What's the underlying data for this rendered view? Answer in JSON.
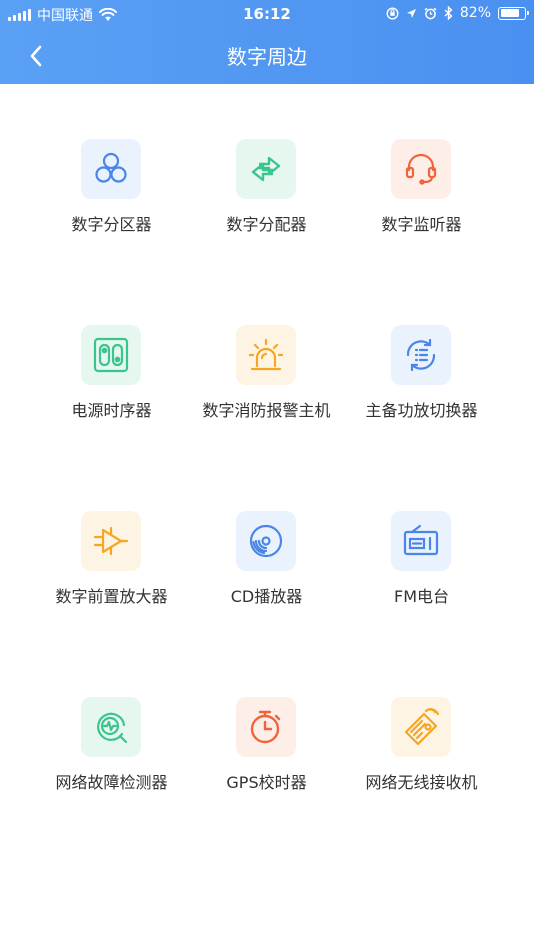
{
  "status_bar": {
    "carrier": "中国联通",
    "time": "16:12",
    "battery": "82%",
    "battery_level": 0.82
  },
  "nav": {
    "title": "数字周边"
  },
  "devices": [
    {
      "label": "数字分区器",
      "icon": "circles-icon",
      "color": "#4a86e8",
      "bg": "#eaf2fd"
    },
    {
      "label": "数字分配器",
      "icon": "swap-arrows-icon",
      "color": "#3cc48e",
      "bg": "#e6f7f0"
    },
    {
      "label": "数字监听器",
      "icon": "headset-icon",
      "color": "#f0643c",
      "bg": "#fdeee8"
    },
    {
      "label": "电源时序器",
      "icon": "power-socket-icon",
      "color": "#3cc48e",
      "bg": "#e6f7f0"
    },
    {
      "label": "数字消防报警主机",
      "icon": "alarm-light-icon",
      "color": "#f5a623",
      "bg": "#fef4e4"
    },
    {
      "label": "主备功放切换器",
      "icon": "switch-list-icon",
      "color": "#4a86e8",
      "bg": "#eaf2fd"
    },
    {
      "label": "数字前置放大器",
      "icon": "amplifier-icon",
      "color": "#f5a623",
      "bg": "#fef4e4"
    },
    {
      "label": "CD播放器",
      "icon": "cd-icon",
      "color": "#4a86e8",
      "bg": "#eaf2fd"
    },
    {
      "label": "FM电台",
      "icon": "radio-icon",
      "color": "#4a86e8",
      "bg": "#eaf2fd"
    },
    {
      "label": "网络故障检测器",
      "icon": "network-check-icon",
      "color": "#3cc48e",
      "bg": "#e6f7f0"
    },
    {
      "label": "GPS校时器",
      "icon": "stopwatch-icon",
      "color": "#f0643c",
      "bg": "#fdeee8"
    },
    {
      "label": "网络无线接收机",
      "icon": "wireless-receiver-icon",
      "color": "#f5a623",
      "bg": "#fef4e4"
    }
  ]
}
